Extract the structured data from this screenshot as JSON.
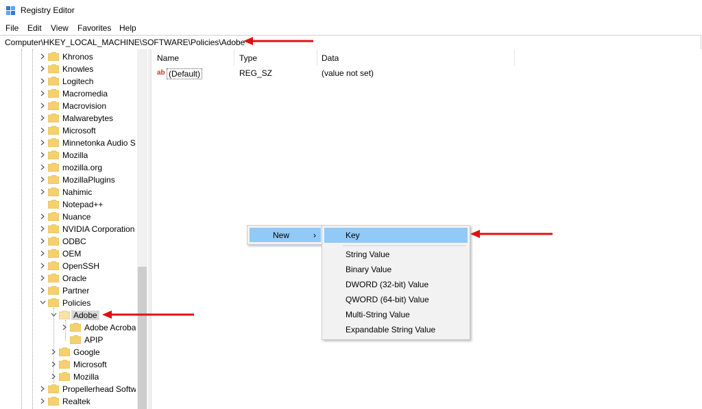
{
  "window": {
    "title": "Registry Editor"
  },
  "menu": [
    "File",
    "Edit",
    "View",
    "Favorites",
    "Help"
  ],
  "address": "Computer\\HKEY_LOCAL_MACHINE\\SOFTWARE\\Policies\\Adobe",
  "tree": [
    "Khronos",
    "Knowles",
    "Logitech",
    "Macromedia",
    "Macrovision",
    "Malwarebytes",
    "Microsoft",
    "Minnetonka Audio S",
    "Mozilla",
    "mozilla.org",
    "MozillaPlugins",
    "Nahimic",
    "Notepad++",
    "Nuance",
    "NVIDIA Corporation",
    "ODBC",
    "OEM",
    "OpenSSH",
    "Oracle",
    "Partner",
    "Policies",
    "Adobe",
    "Adobe Acroba",
    "APIP",
    "Google",
    "Microsoft",
    "Mozilla",
    "Propellerhead Softw",
    "Realtek"
  ],
  "list": {
    "headers": [
      "Name",
      "Type",
      "Data"
    ],
    "rows": [
      {
        "name": "(Default)",
        "type": "REG_SZ",
        "data": "(value not set)"
      }
    ]
  },
  "context_menu": {
    "new_label": "New"
  },
  "submenu": [
    "Key",
    "String Value",
    "Binary Value",
    "DWORD (32-bit) Value",
    "QWORD (64-bit) Value",
    "Multi-String Value",
    "Expandable String Value"
  ],
  "colors": {
    "arrow": "#e01010",
    "folder": "#f5d06f",
    "highlight": "#91c9f7"
  }
}
